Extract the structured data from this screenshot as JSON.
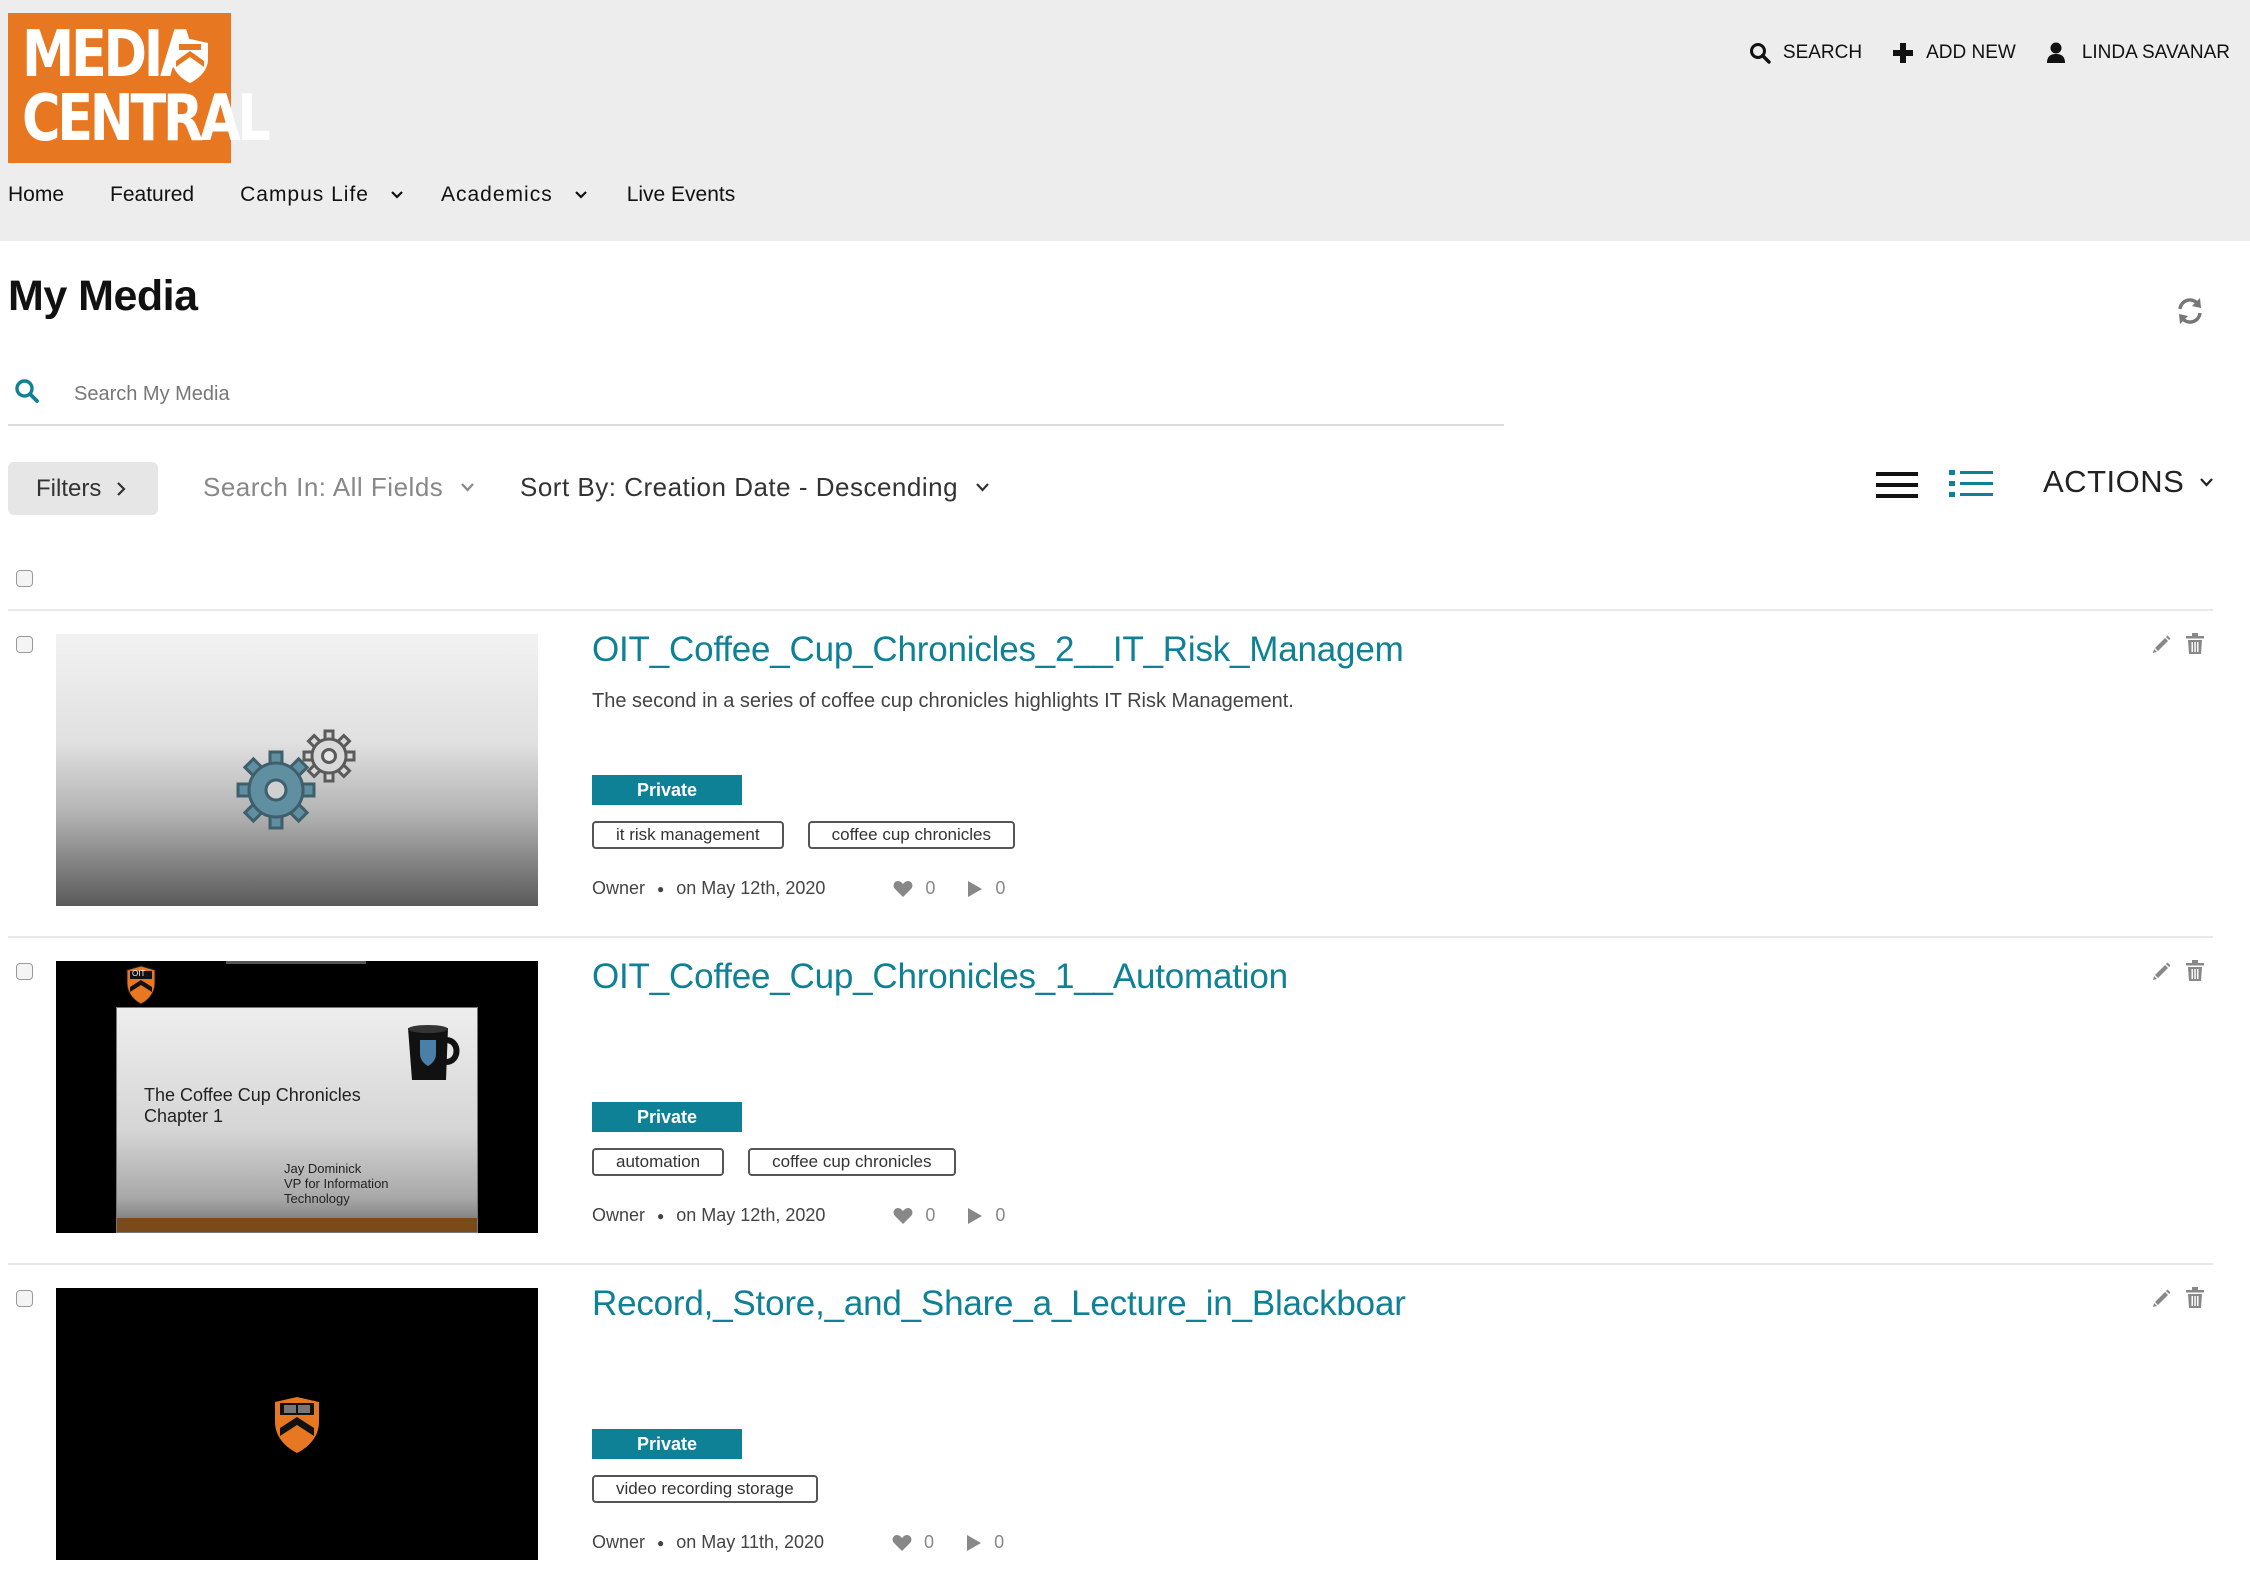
{
  "header": {
    "logo": {
      "line1": "MEDIA",
      "line2": "CENTRAL",
      "brand_color": "#e87722"
    },
    "top_nav": {
      "search_label": "SEARCH",
      "add_new_label": "ADD NEW",
      "user_label": "LINDA SAVANAR"
    },
    "main_nav": [
      {
        "label": "Home",
        "has_dropdown": false
      },
      {
        "label": "Featured",
        "has_dropdown": false
      },
      {
        "label": "Campus Life",
        "has_dropdown": true
      },
      {
        "label": "Academics",
        "has_dropdown": true
      },
      {
        "label": "Live Events",
        "has_dropdown": false
      }
    ]
  },
  "page": {
    "title": "My Media",
    "search": {
      "placeholder": "Search My Media",
      "value": ""
    },
    "toolbar": {
      "filters_label": "Filters",
      "search_in_label": "Search In: All Fields",
      "sort_by_label": "Sort By: Creation Date - Descending",
      "actions_label": "ACTIONS",
      "active_view": "detailed-list"
    }
  },
  "media_items": [
    {
      "title": "OIT_Coffee_Cup_Chronicles_2__IT_Risk_Managem",
      "description": "The second in a series of coffee cup chronicles highlights IT Risk Management.",
      "privacy": "Private",
      "tags": [
        "it risk management",
        "coffee cup chronicles"
      ],
      "owner": "Owner",
      "date": "on May 12th, 2020",
      "likes": "0",
      "plays": "0",
      "thumbnail": {
        "kind": "gears-icon"
      }
    },
    {
      "title": "OIT_Coffee_Cup_Chronicles_1__Automation",
      "description": "",
      "privacy": "Private",
      "tags": [
        "automation",
        "coffee cup chronicles"
      ],
      "owner": "Owner",
      "date": "on May 12th, 2020",
      "likes": "0",
      "plays": "0",
      "thumbnail": {
        "kind": "slide",
        "badge": "OIT",
        "heading_line1": "The Coffee Cup Chronicles",
        "heading_line2": "Chapter 1",
        "presenter_line1": "Jay Dominick",
        "presenter_line2": "VP for Information",
        "presenter_line3": "Technology"
      }
    },
    {
      "title": "Record,_Store,_and_Share_a_Lecture_in_Blackboar",
      "description": "",
      "privacy": "Private",
      "tags": [
        "video recording storage"
      ],
      "owner": "Owner",
      "date": "on May 11th, 2020",
      "likes": "0",
      "plays": "0",
      "thumbnail": {
        "kind": "shield-on-black"
      }
    }
  ],
  "colors": {
    "accent": "#0e8196",
    "header_bg": "#ededed",
    "logo_orange": "#e87722"
  }
}
